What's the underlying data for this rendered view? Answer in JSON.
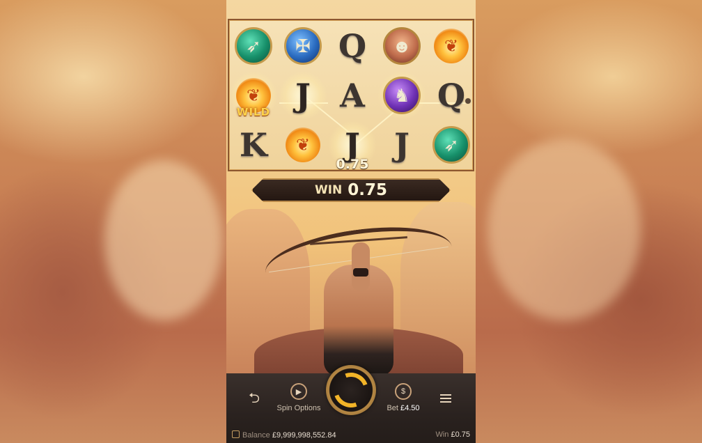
{
  "reels": {
    "row1": [
      {
        "kind": "orb",
        "style": "green",
        "icon": "arrows-icon"
      },
      {
        "kind": "orb",
        "style": "blue",
        "icon": "crossbow-icon"
      },
      {
        "kind": "letter",
        "text": "Q"
      },
      {
        "kind": "orb",
        "style": "hero",
        "icon": "warrior-icon"
      },
      {
        "kind": "phoenix",
        "icon": "phoenix-icon"
      }
    ],
    "row2": [
      {
        "kind": "phoenix",
        "icon": "phoenix-icon",
        "tag": "WILD"
      },
      {
        "kind": "letter",
        "text": "J"
      },
      {
        "kind": "letter",
        "text": "A"
      },
      {
        "kind": "orb",
        "style": "purple",
        "icon": "panther-icon"
      },
      {
        "kind": "letter",
        "text": "Q"
      }
    ],
    "row3": [
      {
        "kind": "letter",
        "text": "K"
      },
      {
        "kind": "phoenix",
        "icon": "phoenix-icon"
      },
      {
        "kind": "letter",
        "text": "J"
      },
      {
        "kind": "letter",
        "text": "J"
      },
      {
        "kind": "orb",
        "style": "green",
        "icon": "arrows-icon"
      }
    ],
    "wild_tag": "WILD",
    "cell_win": "0.75"
  },
  "win_banner": {
    "label": "WIN",
    "amount": "0.75"
  },
  "controls": {
    "spin_options_label": "Spin Options",
    "bet_label": "Bet",
    "bet_value": "£4.50"
  },
  "footer": {
    "balance_label": "Balance",
    "balance_value": "£9,999,998,552.84",
    "win_label": "Win",
    "win_value": "£0.75"
  },
  "colors": {
    "accent": "#f2b428",
    "panel": "#2a221f",
    "frame": "#8c5730"
  }
}
